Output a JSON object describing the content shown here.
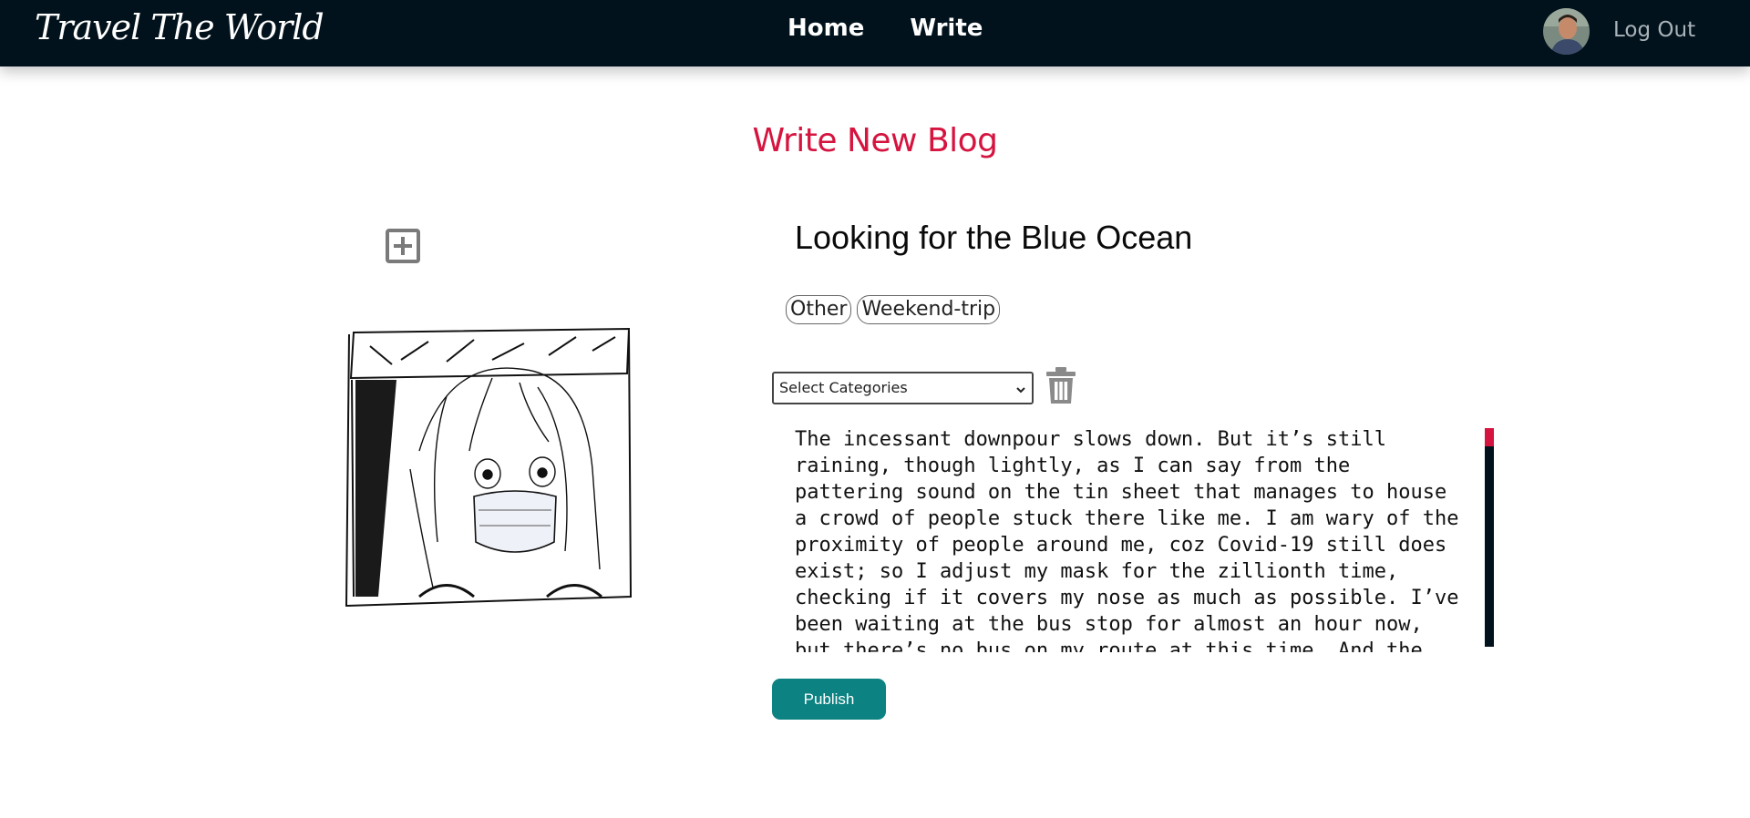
{
  "navbar": {
    "logo": "Travel The World",
    "links": [
      {
        "label": "Home"
      },
      {
        "label": "Write"
      }
    ],
    "logout_label": "Log Out"
  },
  "page": {
    "title": "Write New Blog"
  },
  "post": {
    "title": "Looking for the Blue Ocean",
    "tags": [
      {
        "label": "Other"
      },
      {
        "label": "Weekend-trip"
      }
    ],
    "category_select": {
      "selected": "Select Categories"
    },
    "body_text": "The incessant downpour slows down. But it’s still\nraining, though lightly, as I can say from the\npattering sound on the tin sheet that manages to house\na crowd of people stuck there like me. I am wary of the\nproximity of people around me, coz Covid-19 still does\nexist; so I adjust my mask for the zillionth time,\nchecking if it covers my nose as much as possible. I’ve\nbeen waiting at the bus stop for almost an hour now,\nbut there’s no bus on my route at this time. And the",
    "publish_label": "Publish"
  },
  "icons": {
    "add": "plus-square-icon",
    "delete": "trash-icon",
    "select_arrow": "chevron-down-icon"
  },
  "colors": {
    "navbar_bg": "#02121c",
    "title_accent": "#d5143f",
    "publish_bg": "#0d8282"
  }
}
